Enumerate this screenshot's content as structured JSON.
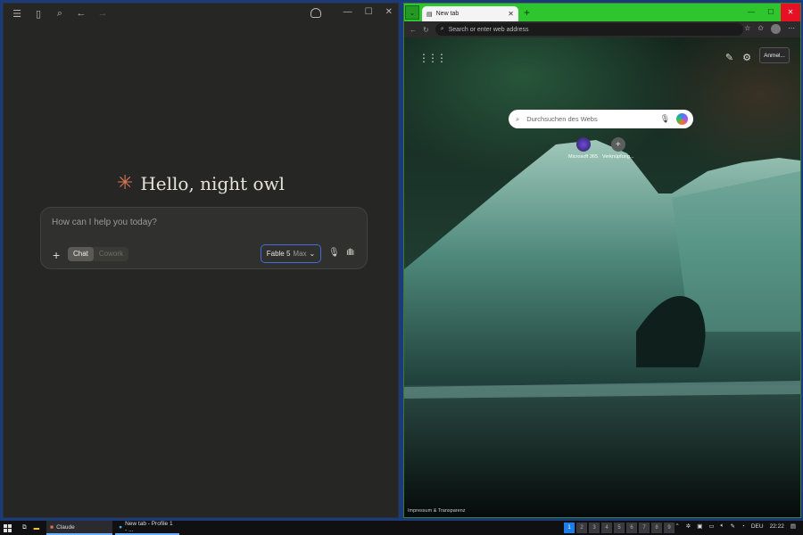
{
  "claude": {
    "greeting": "Hello, night owl",
    "placeholder": "How can I help you today?",
    "mode_chat": "Chat",
    "mode_cowork": "Cowork",
    "model_name": "Fable 5",
    "model_tier": "Max"
  },
  "browser": {
    "tab_title": "New tab",
    "address_placeholder": "Search or enter web address",
    "signin_label": "Anmel...",
    "search_placeholder": "Durchsuchen des Webs",
    "quick_links": [
      {
        "label": "Microsoft 365"
      },
      {
        "label": "Verknüpfung..."
      }
    ],
    "footer": "Impressum & Transparenz"
  },
  "taskbar": {
    "app1": "Claude",
    "app2": "New tab - Profile 1 - ...",
    "desktops": [
      "1",
      "2",
      "3",
      "4",
      "5",
      "6",
      "7",
      "8",
      "9"
    ],
    "language": "DEU",
    "time": "22:22"
  },
  "colors": {
    "accent_orange": "#d97757",
    "tabstrip_green": "#2ec52e",
    "close_red": "#e81123",
    "active_desktop": "#1e7ee8"
  }
}
